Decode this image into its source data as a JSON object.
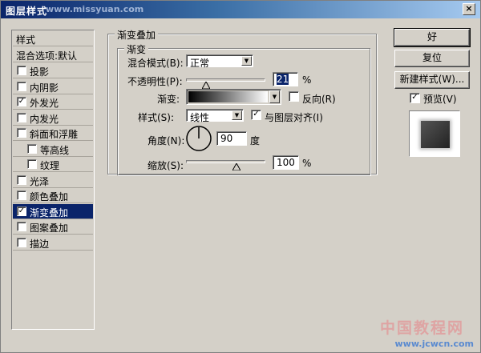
{
  "window": {
    "title": "图层样式",
    "watermark": "www.missyuan.com"
  },
  "styles_list": {
    "header": "样式",
    "blending_default": "混合选项:默认",
    "items": [
      {
        "label": "投影",
        "checked": false
      },
      {
        "label": "内阴影",
        "checked": false
      },
      {
        "label": "外发光",
        "checked": true
      },
      {
        "label": "内发光",
        "checked": false
      },
      {
        "label": "斜面和浮雕",
        "checked": false
      },
      {
        "label": "等高线",
        "checked": false
      },
      {
        "label": "纹理",
        "checked": false
      },
      {
        "label": "光泽",
        "checked": false
      },
      {
        "label": "颜色叠加",
        "checked": false
      },
      {
        "label": "渐变叠加",
        "checked": true,
        "selected": true
      },
      {
        "label": "图案叠加",
        "checked": false
      },
      {
        "label": "描边",
        "checked": false
      }
    ]
  },
  "panel": {
    "outer_legend": "渐变叠加",
    "inner_legend": "渐变",
    "blend_mode_label": "混合模式(B):",
    "blend_mode_value": "正常",
    "opacity_label": "不透明性(P):",
    "opacity_value": "21",
    "percent": "%",
    "gradient_label": "渐变:",
    "reverse_label": "反向(R)",
    "reverse_checked": false,
    "style_label": "样式(S):",
    "style_value": "线性",
    "align_label": "与图层对齐(I)",
    "align_checked": true,
    "angle_label": "角度(N):",
    "angle_value": "90",
    "degree": "度",
    "scale_label": "缩放(S):",
    "scale_value": "100"
  },
  "buttons": {
    "ok": "好",
    "reset": "复位",
    "new_style": "新建样式(W)...",
    "preview_label": "预览(V)",
    "preview_checked": true
  },
  "site_watermark": {
    "cn": "中国教程网",
    "url": "www.jcwcn.com"
  }
}
